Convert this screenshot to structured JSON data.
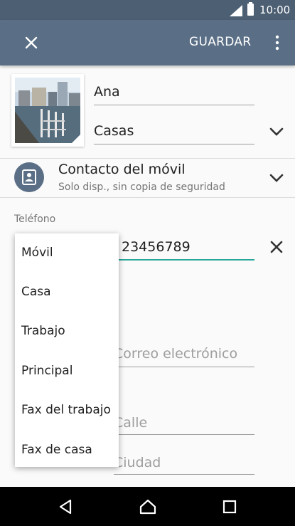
{
  "status_bar": {
    "time": "10:00",
    "icons": [
      "signal-icon",
      "battery-icon"
    ]
  },
  "toolbar": {
    "close_icon": "close-icon",
    "save_label": "GUARDAR",
    "more_icon": "more-vert-icon"
  },
  "contact": {
    "name": "Ana",
    "group": "Casas",
    "account_title": "Contacto del móvil",
    "account_subtitle": "Solo disp., sin copia de seguridad"
  },
  "phone_section": {
    "label": "Teléfono",
    "value": "23456789"
  },
  "fields": {
    "email_placeholder": "Correo electrónico",
    "street_placeholder": "Calle",
    "city_placeholder": "Ciudad"
  },
  "phone_type_menu": {
    "options": [
      "Móvil",
      "Casa",
      "Trabajo",
      "Principal",
      "Fax del trabajo",
      "Fax de casa"
    ]
  },
  "colors": {
    "status_bar": "#4d5f72",
    "toolbar": "#5a6f86",
    "accent": "#26a69a"
  }
}
